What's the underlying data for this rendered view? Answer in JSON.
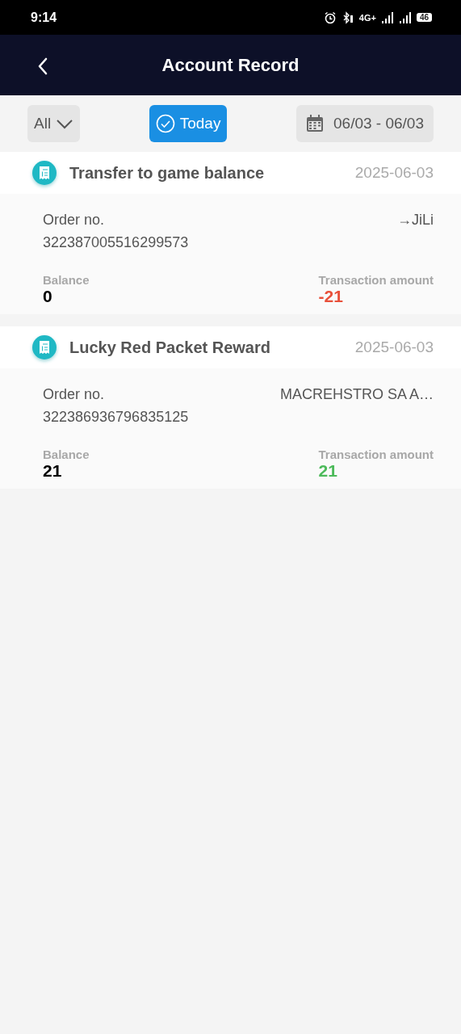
{
  "status_bar": {
    "time": "9:14",
    "network": "4G+",
    "battery": "46"
  },
  "header": {
    "title": "Account Record"
  },
  "filters": [
    {
      "kind": "dropdown",
      "label": "All",
      "selected": false
    },
    {
      "kind": "toggle",
      "label": "Today",
      "selected": true
    },
    {
      "kind": "date",
      "label": "06/03 - 06/03",
      "selected": false
    }
  ],
  "records": [
    {
      "title": "Transfer to game balance",
      "date": "2025-06-03",
      "order_label": "Order no.",
      "order_no": "322387005516299573",
      "target": "→JiLi",
      "balance_label": "Balance",
      "balance": "0",
      "amount_label": "Transaction amount",
      "amount": "-21",
      "kind": "debit"
    },
    {
      "title": "Lucky Red Packet Reward",
      "date": "2025-06-03",
      "order_label": "Order no.",
      "order_no": "322386936796835125",
      "target": "MACREHSTRO SA A…",
      "balance_label": "Balance",
      "balance": "21",
      "amount_label": "Transaction amount",
      "amount": "21",
      "kind": "credit"
    }
  ]
}
